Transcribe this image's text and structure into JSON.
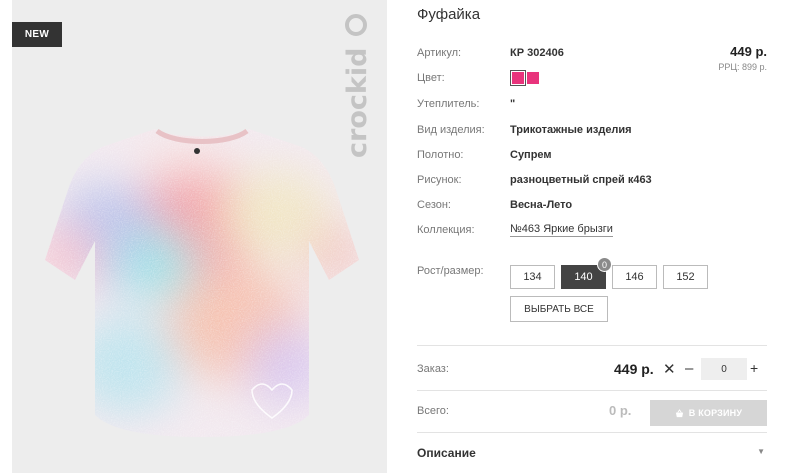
{
  "product_image": {
    "badge": "NEW",
    "brand": "crockid"
  },
  "product": {
    "title": "Фуфайка",
    "price": "449 р.",
    "rrp": "РРЦ: 899 р.",
    "attributes": [
      {
        "label": "Артикул:",
        "value": "КР 302406"
      },
      {
        "label": "Цвет:",
        "value": ""
      },
      {
        "label": "Утеплитель:",
        "value": "\""
      },
      {
        "label": "Вид изделия:",
        "value": "Трикотажные изделия"
      },
      {
        "label": "Полотно:",
        "value": "Супрем"
      },
      {
        "label": "Рисунок:",
        "value": "разноцветный спрей к463"
      },
      {
        "label": "Сезон:",
        "value": "Весна-Лето"
      },
      {
        "label": "Коллекция:",
        "value": "№463 Яркие брызги"
      }
    ],
    "colors": [
      "#e8347c",
      "#e8347c"
    ]
  },
  "sizes": {
    "label": "Рост/размер:",
    "options": [
      {
        "label": "134"
      },
      {
        "label": "140",
        "count": "0",
        "selected": true
      },
      {
        "label": "146"
      },
      {
        "label": "152"
      }
    ],
    "select_all_label": "ВЫБРАТЬ ВСЕ"
  },
  "order": {
    "label": "Заказ:",
    "unit_price": "449 р.",
    "times_symbol": "✕",
    "minus_symbol": "–",
    "quantity": "0",
    "plus_symbol": "+"
  },
  "total": {
    "label": "Всего:",
    "value": "0 р.",
    "cart_button_label": "В КОРЗИНУ",
    "cart_icon": "basket-icon"
  },
  "description": {
    "title": "Описание",
    "toggle_icon": "caret-down-icon"
  }
}
